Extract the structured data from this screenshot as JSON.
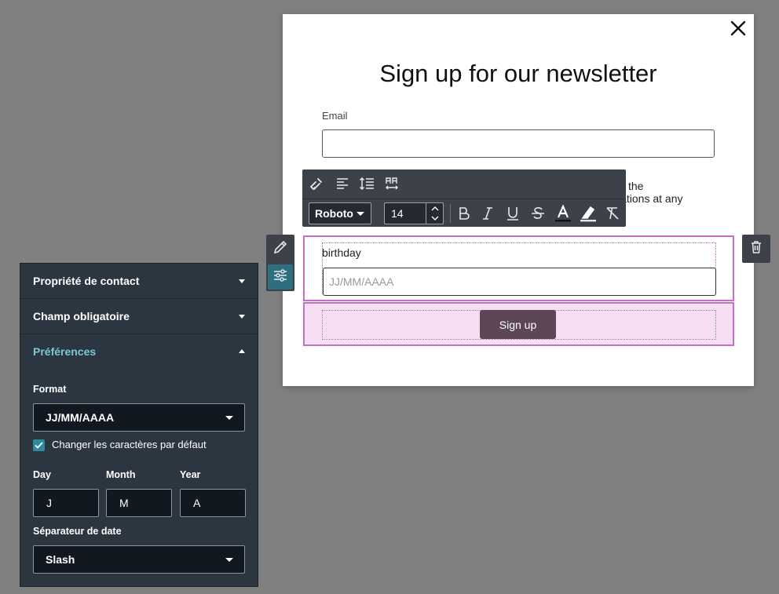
{
  "modal": {
    "title": "Sign up for our newsletter",
    "email_label": "Email",
    "email_value": "",
    "hidden_text_line1": "the",
    "hidden_text_line2": "ications at any",
    "birthday_label": "birthday",
    "birthday_placeholder": "JJ/MM/AAAA",
    "signup_label": "Sign up"
  },
  "toolbar": {
    "font": "Roboto",
    "size": "14"
  },
  "panel": {
    "contact_property": "Propriété de contact",
    "required_field": "Champ obligatoire",
    "preferences": "Préférences",
    "format_label": "Format",
    "format_value": "JJ/MM/AAAA",
    "change_chars_label": "Changer les caractères par défaut",
    "change_chars_checked": true,
    "day_label": "Day",
    "month_label": "Month",
    "year_label": "Year",
    "day_value": "J",
    "month_value": "M",
    "year_value": "A",
    "separator_label": "Séparateur de date",
    "separator_value": "Slash"
  },
  "colors": {
    "background": "#808080",
    "selection_border": "#c56fc6",
    "signup_button": "#5d4658",
    "panel_bg": "#2b3640",
    "accent": "#7fc6d6",
    "checkbox": "#2d8aa0"
  }
}
